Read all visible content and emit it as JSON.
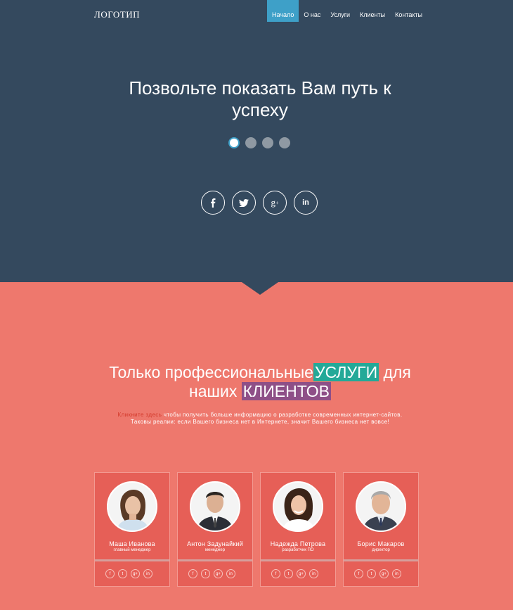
{
  "header": {
    "logo": "ЛОГОТИП",
    "nav": [
      "Начало",
      "О нас",
      "Услуги",
      "Клиенты",
      "Контакты"
    ],
    "active_index": 0
  },
  "hero": {
    "title_line1": "Позвольте показать Вам путь к",
    "title_line2": "успеху",
    "slider_dots": 4,
    "active_dot": 0,
    "social": [
      "facebook-icon",
      "twitter-icon",
      "google-plus-icon",
      "linkedin-icon"
    ]
  },
  "services": {
    "title_part1": "Только профессиональные",
    "title_hl1": "УСЛУГИ",
    "title_part2": " для",
    "title_line2_part1": "наших ",
    "title_hl2": "КЛИЕНТОВ",
    "text_link": "Кликните здесь",
    "text_1": " чтобы получить больше информацию о разработке современных интернет-сайтов.",
    "text_2": "Таковы реалии: если Вашего бизнеса нет в Интернете, значит Вашего бизнеса нет вовсе!"
  },
  "team": [
    {
      "name": "Маша Иванова",
      "role": "главный менеджер"
    },
    {
      "name": "Антон Задунайкий",
      "role": "менеджер"
    },
    {
      "name": "Надежда Петрова",
      "role": "разработчик ПО"
    },
    {
      "name": "Борис Макаров",
      "role": "директор"
    }
  ],
  "colors": {
    "hero_bg": "#34495e",
    "accent_blue": "#3ea0c8",
    "coral_bg": "#ee786d",
    "card_bg": "#e65f57",
    "highlight_teal": "#23a998",
    "highlight_purple": "#8e4f87"
  }
}
